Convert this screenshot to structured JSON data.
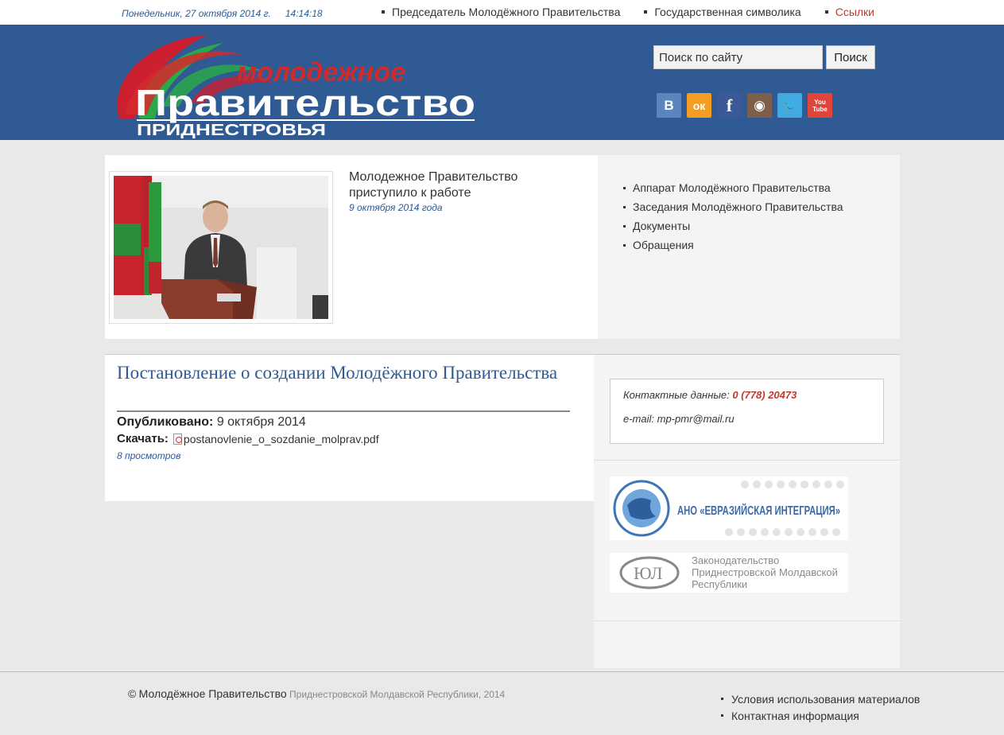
{
  "topbar": {
    "date": "Понедельник, 27 октября 2014 г.",
    "time": "14:14:18",
    "nav": [
      {
        "label": "Председатель Молодёжного Правительства"
      },
      {
        "label": "Государственная символика"
      },
      {
        "label": "Ссылки"
      }
    ]
  },
  "header": {
    "logo_line1": "молодежное",
    "logo_line2": "Правительство",
    "logo_line3": "ПРИДНЕСТРОВЬЯ",
    "search_placeholder": "Поиск по сайту",
    "search_button": "Поиск",
    "social": [
      {
        "icon": "vk-icon",
        "glyph": "В"
      },
      {
        "icon": "odnoklassniki-icon",
        "glyph": "ок"
      },
      {
        "icon": "facebook-icon",
        "glyph": "f"
      },
      {
        "icon": "instagram-icon",
        "glyph": "◉"
      },
      {
        "icon": "twitter-icon",
        "glyph": "🐦"
      },
      {
        "icon": "youtube-icon",
        "glyph": "You Tube"
      }
    ]
  },
  "featured": {
    "title": "Молодежное Правительство приступило к работе",
    "date": "9 октября 2014 года"
  },
  "sidenav": [
    {
      "label": "Аппарат Молодёжного Правительства"
    },
    {
      "label": "Заседания Молодёжного Правительства"
    },
    {
      "label": "Документы"
    },
    {
      "label": "Обращения"
    }
  ],
  "article": {
    "title": "Постановление о создании Молодёжного Правительства",
    "published_label": "Опубликовано:",
    "published_value": "9 октября 2014",
    "download_label": "Скачать:",
    "file_name": "postanovlenie_o_sozdanie_molprav.pdf",
    "views": "8 просмотров"
  },
  "contact": {
    "label": "Контактные данные:",
    "phone": "0 (778) 20473",
    "email": "e-mail: mp-pmr@mail.ru"
  },
  "banners": {
    "b1_text": "АНО «ЕВРАЗИЙСКАЯ ИНТЕГРАЦИЯ»",
    "b2_line1": "Законодательство",
    "b2_line2": "Приднестровской Молдавской",
    "b2_line3": "Республики"
  },
  "footer": {
    "copy_sign": "©",
    "copy_main": "Молодёжное Правительство",
    "copy_rest": "Приднестровской Молдавской Республики, 2014",
    "nav": [
      {
        "label": "Условия использования материалов"
      },
      {
        "label": "Контактная информация"
      }
    ]
  },
  "colors": {
    "header_bg": "#2f5a94",
    "accent_red": "#c0392b",
    "link_blue": "#2a5a9a"
  }
}
